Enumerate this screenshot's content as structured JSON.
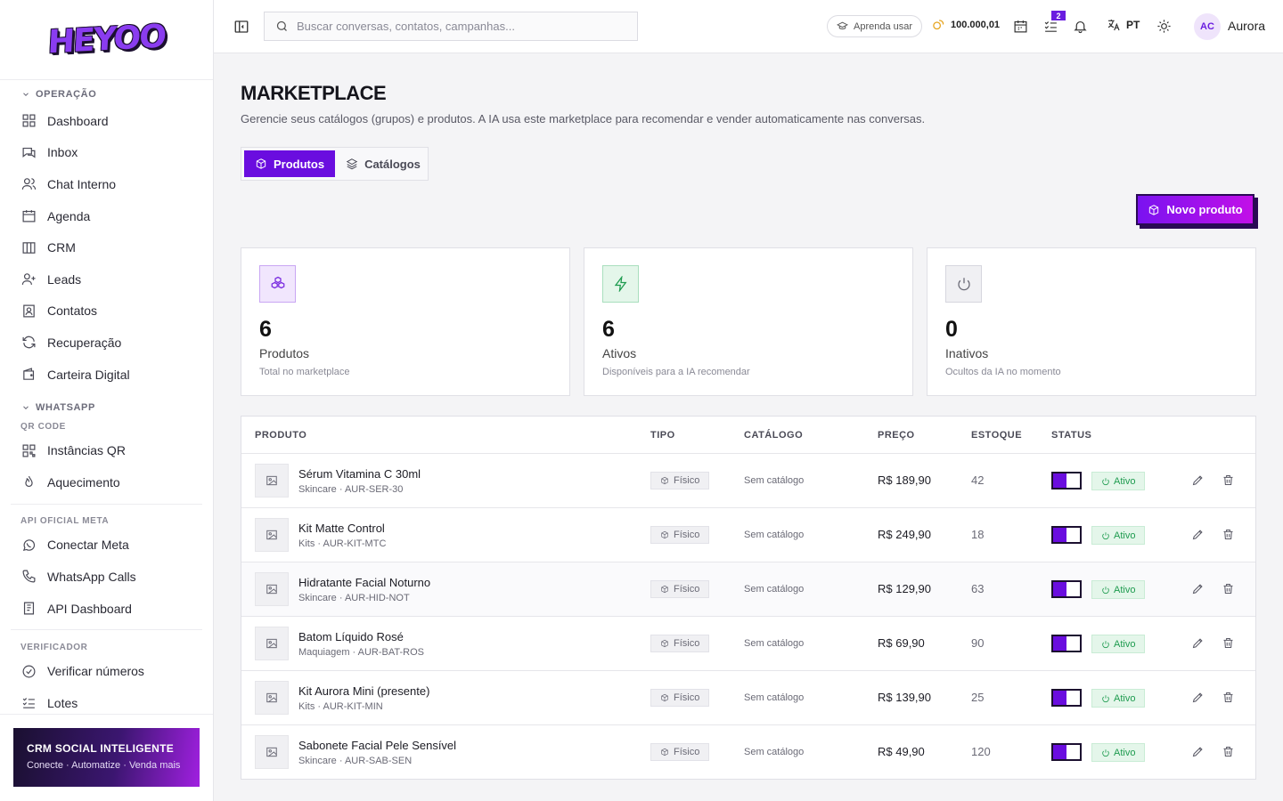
{
  "brand": {
    "logo": "HEYOO"
  },
  "sidebar": {
    "sections": [
      {
        "title": "OPERAÇÃO",
        "items": [
          "Dashboard",
          "Inbox",
          "Chat Interno",
          "Agenda",
          "CRM",
          "Leads",
          "Contatos",
          "Recuperação",
          "Carteira Digital"
        ]
      },
      {
        "title": "WHATSAPP",
        "sub": "QR CODE",
        "items": [
          "Instâncias QR",
          "Aquecimento"
        ]
      },
      {
        "title": "API OFICIAL META",
        "items": [
          "Conectar Meta",
          "WhatsApp Calls",
          "API Dashboard"
        ]
      },
      {
        "title": "VERIFICADOR",
        "items": [
          "Verificar números",
          "Lotes"
        ]
      }
    ],
    "promo": {
      "title": "CRM SOCIAL INTELIGENTE",
      "subtitle": "Conecte · Automatize · Venda mais"
    }
  },
  "topbar": {
    "search_placeholder": "Buscar conversas, contatos, campanhas...",
    "learn_label": "Aprenda usar",
    "credits": "100.000,01",
    "tasks_badge": "2",
    "language": "PT",
    "user_initials": "AC",
    "user_name": "Aurora"
  },
  "page": {
    "title": "MARKETPLACE",
    "subtitle": "Gerencie seus catálogos (grupos) e produtos. A IA usa este marketplace para recomendar e vender automaticamente nas conversas.",
    "tabs": [
      {
        "label": "Produtos",
        "active": true
      },
      {
        "label": "Catálogos",
        "active": false
      }
    ],
    "new_button": "Novo produto"
  },
  "stats": [
    {
      "value": "6",
      "label": "Produtos",
      "desc": "Total no marketplace",
      "icon": "boxes-icon",
      "color": "#7a2ce0",
      "bg": "#f1e6fd",
      "border": "#c9a6f3"
    },
    {
      "value": "6",
      "label": "Ativos",
      "desc": "Disponíveis para a IA recomendar",
      "icon": "zap-icon",
      "color": "#1e9b4f",
      "bg": "#e4f6ea",
      "border": "#a9dfbe"
    },
    {
      "value": "0",
      "label": "Inativos",
      "desc": "Ocultos da IA no momento",
      "icon": "power-icon",
      "color": "#6a6a76",
      "bg": "#f0f0f3",
      "border": "#d6d6de"
    }
  ],
  "table": {
    "headers": [
      "PRODUTO",
      "TIPO",
      "CATÁLOGO",
      "PREÇO",
      "ESTOQUE",
      "STATUS"
    ],
    "rows": [
      {
        "name": "Sérum Vitamina C 30ml",
        "meta": "Skincare · AUR-SER-30",
        "type": "Físico",
        "catalog": "Sem catálogo",
        "price": "R$ 189,90",
        "stock": "42",
        "status": "Ativo"
      },
      {
        "name": "Kit Matte Control",
        "meta": "Kits · AUR-KIT-MTC",
        "type": "Físico",
        "catalog": "Sem catálogo",
        "price": "R$ 249,90",
        "stock": "18",
        "status": "Ativo"
      },
      {
        "name": "Hidratante Facial Noturno",
        "meta": "Skincare · AUR-HID-NOT",
        "type": "Físico",
        "catalog": "Sem catálogo",
        "price": "R$ 129,90",
        "stock": "63",
        "status": "Ativo"
      },
      {
        "name": "Batom Líquido Rosé",
        "meta": "Maquiagem · AUR-BAT-ROS",
        "type": "Físico",
        "catalog": "Sem catálogo",
        "price": "R$ 69,90",
        "stock": "90",
        "status": "Ativo"
      },
      {
        "name": "Kit Aurora Mini (presente)",
        "meta": "Kits · AUR-KIT-MIN",
        "type": "Físico",
        "catalog": "Sem catálogo",
        "price": "R$ 139,90",
        "stock": "25",
        "status": "Ativo"
      },
      {
        "name": "Sabonete Facial Pele Sensível",
        "meta": "Skincare · AUR-SAB-SEN",
        "type": "Físico",
        "catalog": "Sem catálogo",
        "price": "R$ 49,90",
        "stock": "120",
        "status": "Ativo"
      }
    ]
  },
  "colors": {
    "accent": "#6a0ddf",
    "success": "#1e9b4f"
  }
}
